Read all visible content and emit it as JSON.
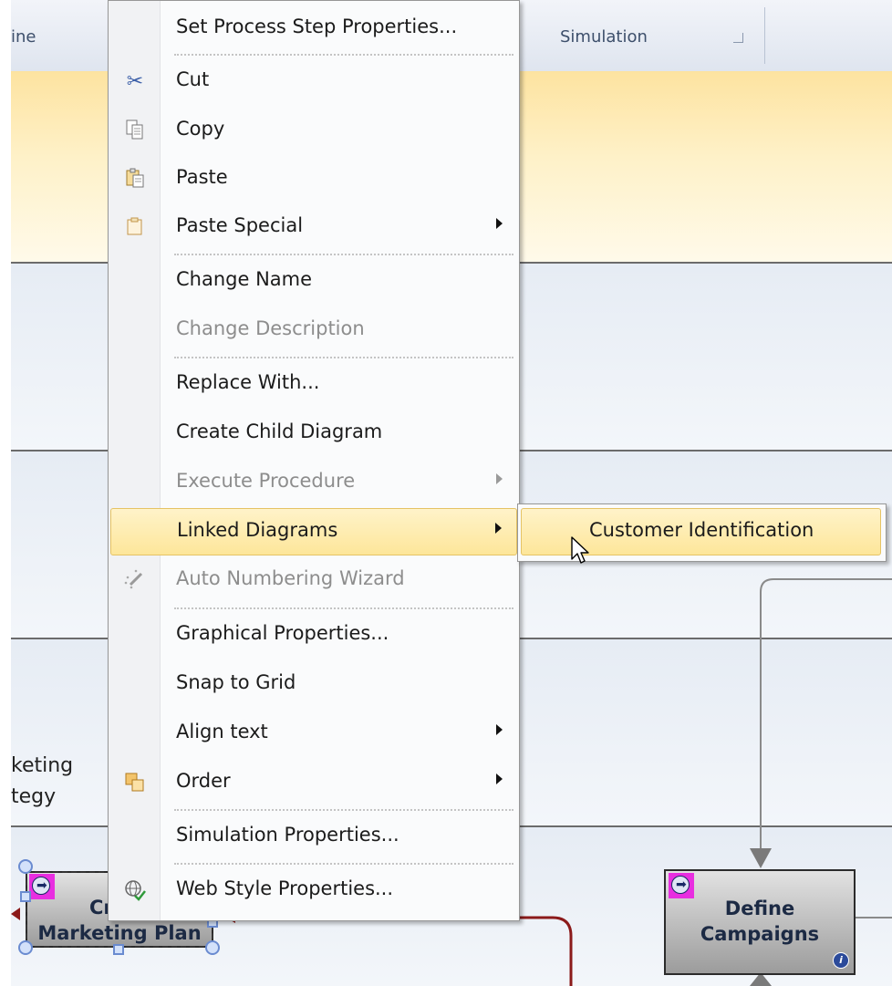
{
  "ribbon": {
    "partial_group_label": "ine",
    "simulation_group_label": "Simulation"
  },
  "lanes": {
    "partial_label_line1": "keting",
    "partial_label_line2": "tegy"
  },
  "shapes": {
    "create_plan": {
      "text_line1": "Cr",
      "text_line2": "Marketing Plan"
    },
    "define_campaigns": {
      "text_line1": "Define",
      "text_line2": "Campaigns",
      "info_glyph": "i"
    }
  },
  "context_menu": {
    "items": [
      {
        "label": "Set Process Step Properties...",
        "icon": "none",
        "enabled": true
      },
      {
        "label": "Cut",
        "icon": "scissors-icon",
        "enabled": true
      },
      {
        "label": "Copy",
        "icon": "copy-icon",
        "enabled": true
      },
      {
        "label": "Paste",
        "icon": "paste-icon",
        "enabled": true
      },
      {
        "label": "Paste Special",
        "icon": "paste-special-icon",
        "enabled": true,
        "submenu": true
      },
      {
        "label": "Change Name",
        "icon": "none",
        "enabled": true
      },
      {
        "label": "Change Description",
        "icon": "none",
        "enabled": false
      },
      {
        "label": "Replace With...",
        "icon": "none",
        "enabled": true
      },
      {
        "label": "Create Child Diagram",
        "icon": "none",
        "enabled": true
      },
      {
        "label": "Execute Procedure",
        "icon": "none",
        "enabled": false,
        "submenu": true
      },
      {
        "label": "Linked Diagrams",
        "icon": "none",
        "enabled": true,
        "submenu": true,
        "highlighted": true
      },
      {
        "label": "Auto Numbering Wizard",
        "icon": "magic-wand-icon",
        "enabled": false
      },
      {
        "label": "Graphical Properties...",
        "icon": "none",
        "enabled": true
      },
      {
        "label": "Snap to Grid",
        "icon": "none",
        "enabled": true
      },
      {
        "label": "Align text",
        "icon": "none",
        "enabled": true,
        "submenu": true
      },
      {
        "label": "Order",
        "icon": "order-icon",
        "enabled": true,
        "submenu": true
      },
      {
        "label": "Simulation Properties...",
        "icon": "none",
        "enabled": true
      },
      {
        "label": "Web Style Properties...",
        "icon": "web-style-icon",
        "enabled": true
      }
    ]
  },
  "submenu": {
    "items": [
      {
        "label": "Customer Identification",
        "highlighted": true
      }
    ]
  },
  "colors": {
    "menu_highlight": "#fde69a",
    "lane_yellow": "#fde3a0",
    "magenta_badge": "#e82ee0",
    "connector_red": "#8b1a1a"
  }
}
